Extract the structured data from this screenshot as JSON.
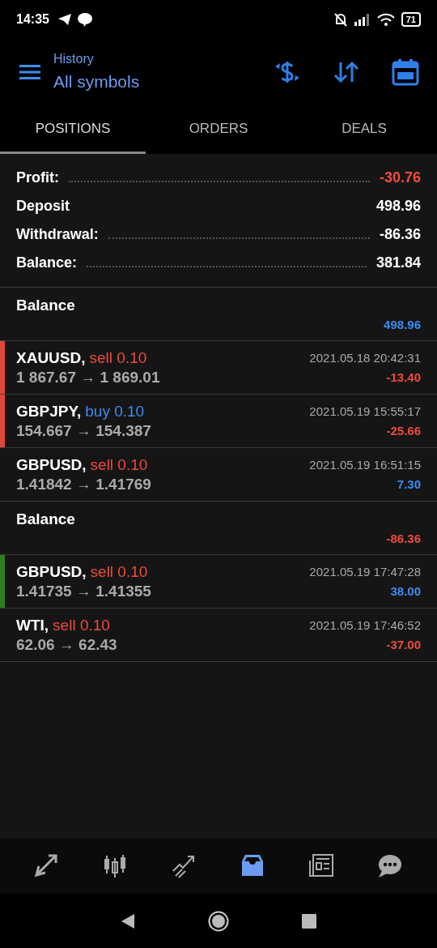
{
  "status_bar": {
    "time": "14:35",
    "battery": "71"
  },
  "header": {
    "subtitle": "History",
    "title": "All symbols"
  },
  "tabs": [
    {
      "label": "POSITIONS",
      "selected": true
    },
    {
      "label": "ORDERS",
      "selected": false
    },
    {
      "label": "DEALS",
      "selected": false
    }
  ],
  "summary": [
    {
      "label": "Profit:",
      "value": "-30.76",
      "loss": true,
      "leader": true
    },
    {
      "label": "Deposit",
      "value": "498.96",
      "loss": false,
      "leader": false
    },
    {
      "label": "Withdrawal:",
      "value": "-86.36",
      "loss": false,
      "leader": true
    },
    {
      "label": "Balance:",
      "value": "381.84",
      "loss": false,
      "leader": true
    }
  ],
  "entries": [
    {
      "kind": "balance",
      "label": "Balance",
      "amount": "498.96",
      "positive": true
    },
    {
      "kind": "trade",
      "symbol": "XAUUSD,",
      "buy": false,
      "order": "sell 0.10",
      "prices": "1 867.67 → 1 869.01",
      "time": "2021.05.18 20:42:31",
      "amount": "-13.40",
      "positive": false,
      "color": "#e0473c"
    },
    {
      "kind": "trade",
      "symbol": "GBPJPY,",
      "buy": true,
      "order": "buy 0.10",
      "prices": "154.667 → 154.387",
      "time": "2021.05.19 15:55:17",
      "amount": "-25.66",
      "positive": false,
      "color": "#e0473c"
    },
    {
      "kind": "trade",
      "symbol": "GBPUSD,",
      "buy": false,
      "order": "sell 0.10",
      "prices": "1.41842 → 1.41769",
      "time": "2021.05.19 16:51:15",
      "amount": "7.30",
      "positive": true
    },
    {
      "kind": "balance",
      "label": "Balance",
      "amount": "-86.36",
      "positive": false
    },
    {
      "kind": "trade",
      "symbol": "GBPUSD,",
      "buy": false,
      "order": "sell 0.10",
      "prices": "1.41735 → 1.41355",
      "time": "2021.05.19 17:47:28",
      "amount": "38.00",
      "positive": true,
      "color": "#2e7d1e"
    },
    {
      "kind": "trade",
      "symbol": "WTI,",
      "buy": false,
      "order": "sell 0.10",
      "prices": "62.06 → 62.43",
      "time": "2021.05.19 17:46:52",
      "amount": "-37.00",
      "positive": false
    }
  ],
  "bottom_nav": [
    {
      "kind": "quotes",
      "selected": false
    },
    {
      "kind": "chart",
      "selected": false
    },
    {
      "kind": "trade",
      "selected": false
    },
    {
      "kind": "history",
      "selected": true
    },
    {
      "kind": "news",
      "selected": false
    },
    {
      "kind": "messages",
      "selected": false
    }
  ]
}
